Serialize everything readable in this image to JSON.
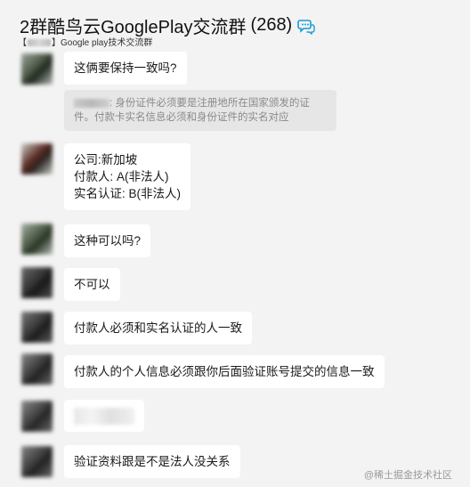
{
  "header": {
    "title": "2群酷鸟云GooglePlay交流群",
    "member_count": "(268)",
    "subtitle": "Google play技术交流群",
    "subtitle_prefix": "【"
  },
  "messages": [
    {
      "type": "text",
      "lines": [
        "这俩要保持一致吗?"
      ]
    },
    {
      "type": "system",
      "text": ": 身份证件必须要是注册地所在国家颁发的证件。付款卡实名信息必须和身份证件的实名对应"
    },
    {
      "type": "text",
      "lines": [
        "公司:新加坡",
        "付款人: A(非法人)",
        "实名认证: B(非法人)"
      ]
    },
    {
      "type": "text",
      "lines": [
        "这种可以吗?"
      ]
    },
    {
      "type": "text",
      "lines": [
        "不可以"
      ]
    },
    {
      "type": "text",
      "lines": [
        "付款人必须和实名认证的人一致"
      ]
    },
    {
      "type": "text",
      "lines": [
        "付款人的个人信息必须跟你后面验证账号提交的信息一致"
      ]
    },
    {
      "type": "redacted"
    },
    {
      "type": "text",
      "lines": [
        "验证资料跟是不是法人没关系"
      ]
    }
  ],
  "watermark": "@稀土掘金技术社区",
  "colors": {
    "background": "#f3f3f3",
    "bubble": "#ffffff",
    "system_bubble": "#e6e6e6",
    "icon_accent": "#1a9bd7"
  },
  "icons": {
    "group_chat": "chat-bubbles-icon"
  }
}
